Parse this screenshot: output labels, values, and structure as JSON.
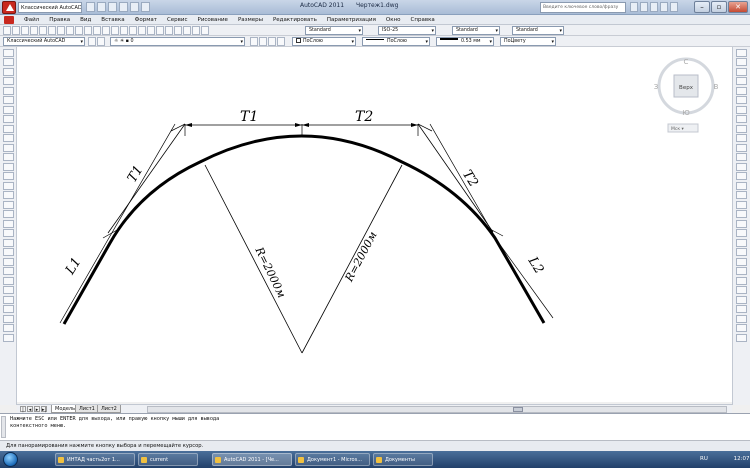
{
  "titlebar": {
    "workspace": "Классический AutoCAD",
    "app_title": "AutoCAD 2011",
    "document_title": "Чертеж1.dwg",
    "search_placeholder": "Введите ключевое слово/фразу"
  },
  "menu": {
    "items": [
      "Файл",
      "Правка",
      "Вид",
      "Вставка",
      "Формат",
      "Сервис",
      "Рисование",
      "Размеры",
      "Редактировать",
      "Параметризация",
      "Окно",
      "Справка"
    ]
  },
  "toolbar1": {
    "text_style": "Standard",
    "dim_style": "ISO-25",
    "table_style": "Standard",
    "mleader_style": "Standard"
  },
  "toolbar2": {
    "workspace": "Классический AutoCAD",
    "layer": "0",
    "color": "ПоСлою",
    "linetype": "ПоСлою",
    "lineweight": "0.53 мм",
    "plotstyle": "ПоЦвету"
  },
  "drawing": {
    "labels": {
      "T1_top": "T1",
      "T2_top": "T2",
      "T1_left": "T1",
      "T2_right": "T2",
      "L1": "L1",
      "L2": "L2",
      "R_left": "R=2000м",
      "R_right": "R=2000м"
    }
  },
  "viewcube": {
    "top_face": "Верх",
    "north": "С",
    "south": "Ю",
    "west": "З",
    "east": "В",
    "wcs": "Мск"
  },
  "layout_tabs": [
    "Модель",
    "Лист1",
    "Лист2"
  ],
  "command_line": [
    "Нажмите ESC или ENTER для выхода, или правую кнопку мыши для вывода",
    "контекстного меню."
  ],
  "status_bar": "Для панорамирования нажмите кнопку выбора и перемещайте курсор.",
  "taskbar": {
    "items": [
      {
        "label": "ИНТАД часть2от 1..."
      },
      {
        "label": "current"
      },
      {
        "label": "AutoCAD 2011 - [Че..."
      },
      {
        "label": "Документ1 - Micros..."
      },
      {
        "label": "Документы"
      }
    ],
    "lang": "RU",
    "clock": "12:07"
  },
  "colors": {
    "app_red": "#c8281f",
    "title_blue": "#a9bcd6",
    "taskbar_blue": "#22406a"
  }
}
